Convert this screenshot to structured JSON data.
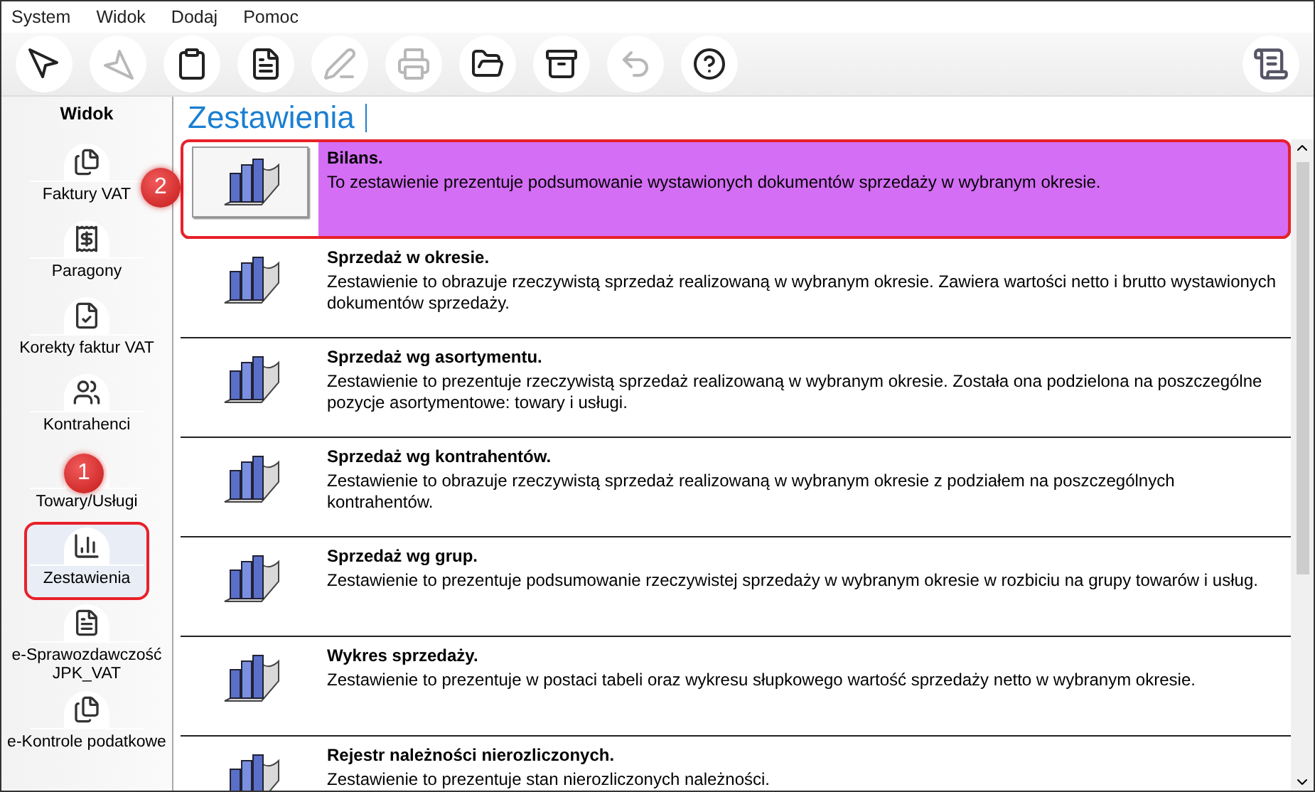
{
  "menu": [
    {
      "label": "System"
    },
    {
      "label": "Widok"
    },
    {
      "label": "Dodaj"
    },
    {
      "label": "Pomoc"
    }
  ],
  "toolbar": [
    {
      "disabled": false
    },
    {
      "disabled": true
    },
    {
      "disabled": false
    },
    {
      "disabled": false
    },
    {
      "disabled": true
    },
    {
      "disabled": true
    },
    {
      "disabled": false
    },
    {
      "disabled": false
    },
    {
      "disabled": true
    },
    {
      "disabled": false
    }
  ],
  "sidebar": {
    "title": "Widok",
    "items": [
      {
        "label": "Faktury VAT",
        "selected": false,
        "highlighted": false
      },
      {
        "label": "Paragony",
        "selected": false,
        "highlighted": false
      },
      {
        "label": "Korekty faktur VAT",
        "selected": false,
        "highlighted": false
      },
      {
        "label": "Kontrahenci",
        "selected": false,
        "highlighted": false
      },
      {
        "label": "Towary/Usługi",
        "selected": false,
        "highlighted": false
      },
      {
        "label": "Zestawienia",
        "selected": true,
        "highlighted": true
      },
      {
        "label": "e-Sprawozdawczość JPK_VAT",
        "selected": false,
        "highlighted": false
      },
      {
        "label": "e-Kontrole podatkowe",
        "selected": false,
        "highlighted": false
      }
    ]
  },
  "main": {
    "title": "Zestawienia",
    "reports": [
      {
        "title": "Bilans.",
        "description": "To zestawienie prezentuje podsumowanie wystawionych dokumentów sprzedaży w wybranym okresie.",
        "selected": true,
        "highlighted": true
      },
      {
        "title": "Sprzedaż w okresie.",
        "description": "Zestawienie to obrazuje rzeczywistą sprzedaż realizowaną w wybranym okresie. Zawiera wartości netto i brutto wystawionych dokumentów sprzedaży.",
        "selected": false,
        "highlighted": false
      },
      {
        "title": "Sprzedaż wg asortymentu.",
        "description": "Zestawienie to prezentuje rzeczywistą sprzedaż realizowaną w wybranym okresie. Została ona podzielona na poszczególne pozycje asortymentowe: towary i usługi.",
        "selected": false,
        "highlighted": false
      },
      {
        "title": "Sprzedaż wg kontrahentów.",
        "description": "Zestawienie to obrazuje rzeczywistą sprzedaż realizowaną w wybranym okresie z podziałem na poszczególnych kontrahentów.",
        "selected": false,
        "highlighted": false
      },
      {
        "title": "Sprzedaż wg grup.",
        "description": "Zestawienie to prezentuje podsumowanie rzeczywistej sprzedaży w wybranym okresie w rozbiciu na grupy towarów i usług.",
        "selected": false,
        "highlighted": false
      },
      {
        "title": "Wykres sprzedaży.",
        "description": "Zestawienie to prezentuje w postaci tabeli oraz wykresu słupkowego wartość sprzedaży netto w wybranym okresie.",
        "selected": false,
        "highlighted": false
      },
      {
        "title": "Rejestr należności nierozliczonych.",
        "description": "Zestawienie to prezentuje stan nierozliczonych należności.",
        "selected": false,
        "highlighted": false
      }
    ]
  },
  "annotations": [
    {
      "label": "2"
    },
    {
      "label": "1"
    }
  ]
}
